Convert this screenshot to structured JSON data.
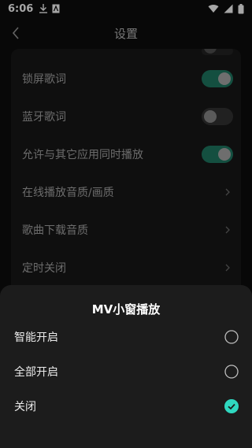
{
  "status_bar": {
    "time": "6:06"
  },
  "header": {
    "title": "设置"
  },
  "settings": {
    "rows": [
      {
        "label": "锁屏歌词",
        "type": "toggle",
        "on": true
      },
      {
        "label": "蓝牙歌词",
        "type": "toggle",
        "on": false
      },
      {
        "label": "允许与其它应用同时播放",
        "type": "toggle",
        "on": true
      },
      {
        "label": "在线播放音质/画质",
        "type": "nav"
      },
      {
        "label": "歌曲下载音质",
        "type": "nav"
      },
      {
        "label": "定时关闭",
        "type": "nav"
      }
    ]
  },
  "sheet": {
    "title": "MV小窗播放",
    "options": [
      {
        "label": "智能开启",
        "selected": false
      },
      {
        "label": "全部开启",
        "selected": false
      },
      {
        "label": "关闭",
        "selected": true
      }
    ]
  },
  "colors": {
    "accent": "#2fd8c0",
    "toggle_on": "#1f7a63",
    "sheet_bg": "#1c1c1c"
  }
}
